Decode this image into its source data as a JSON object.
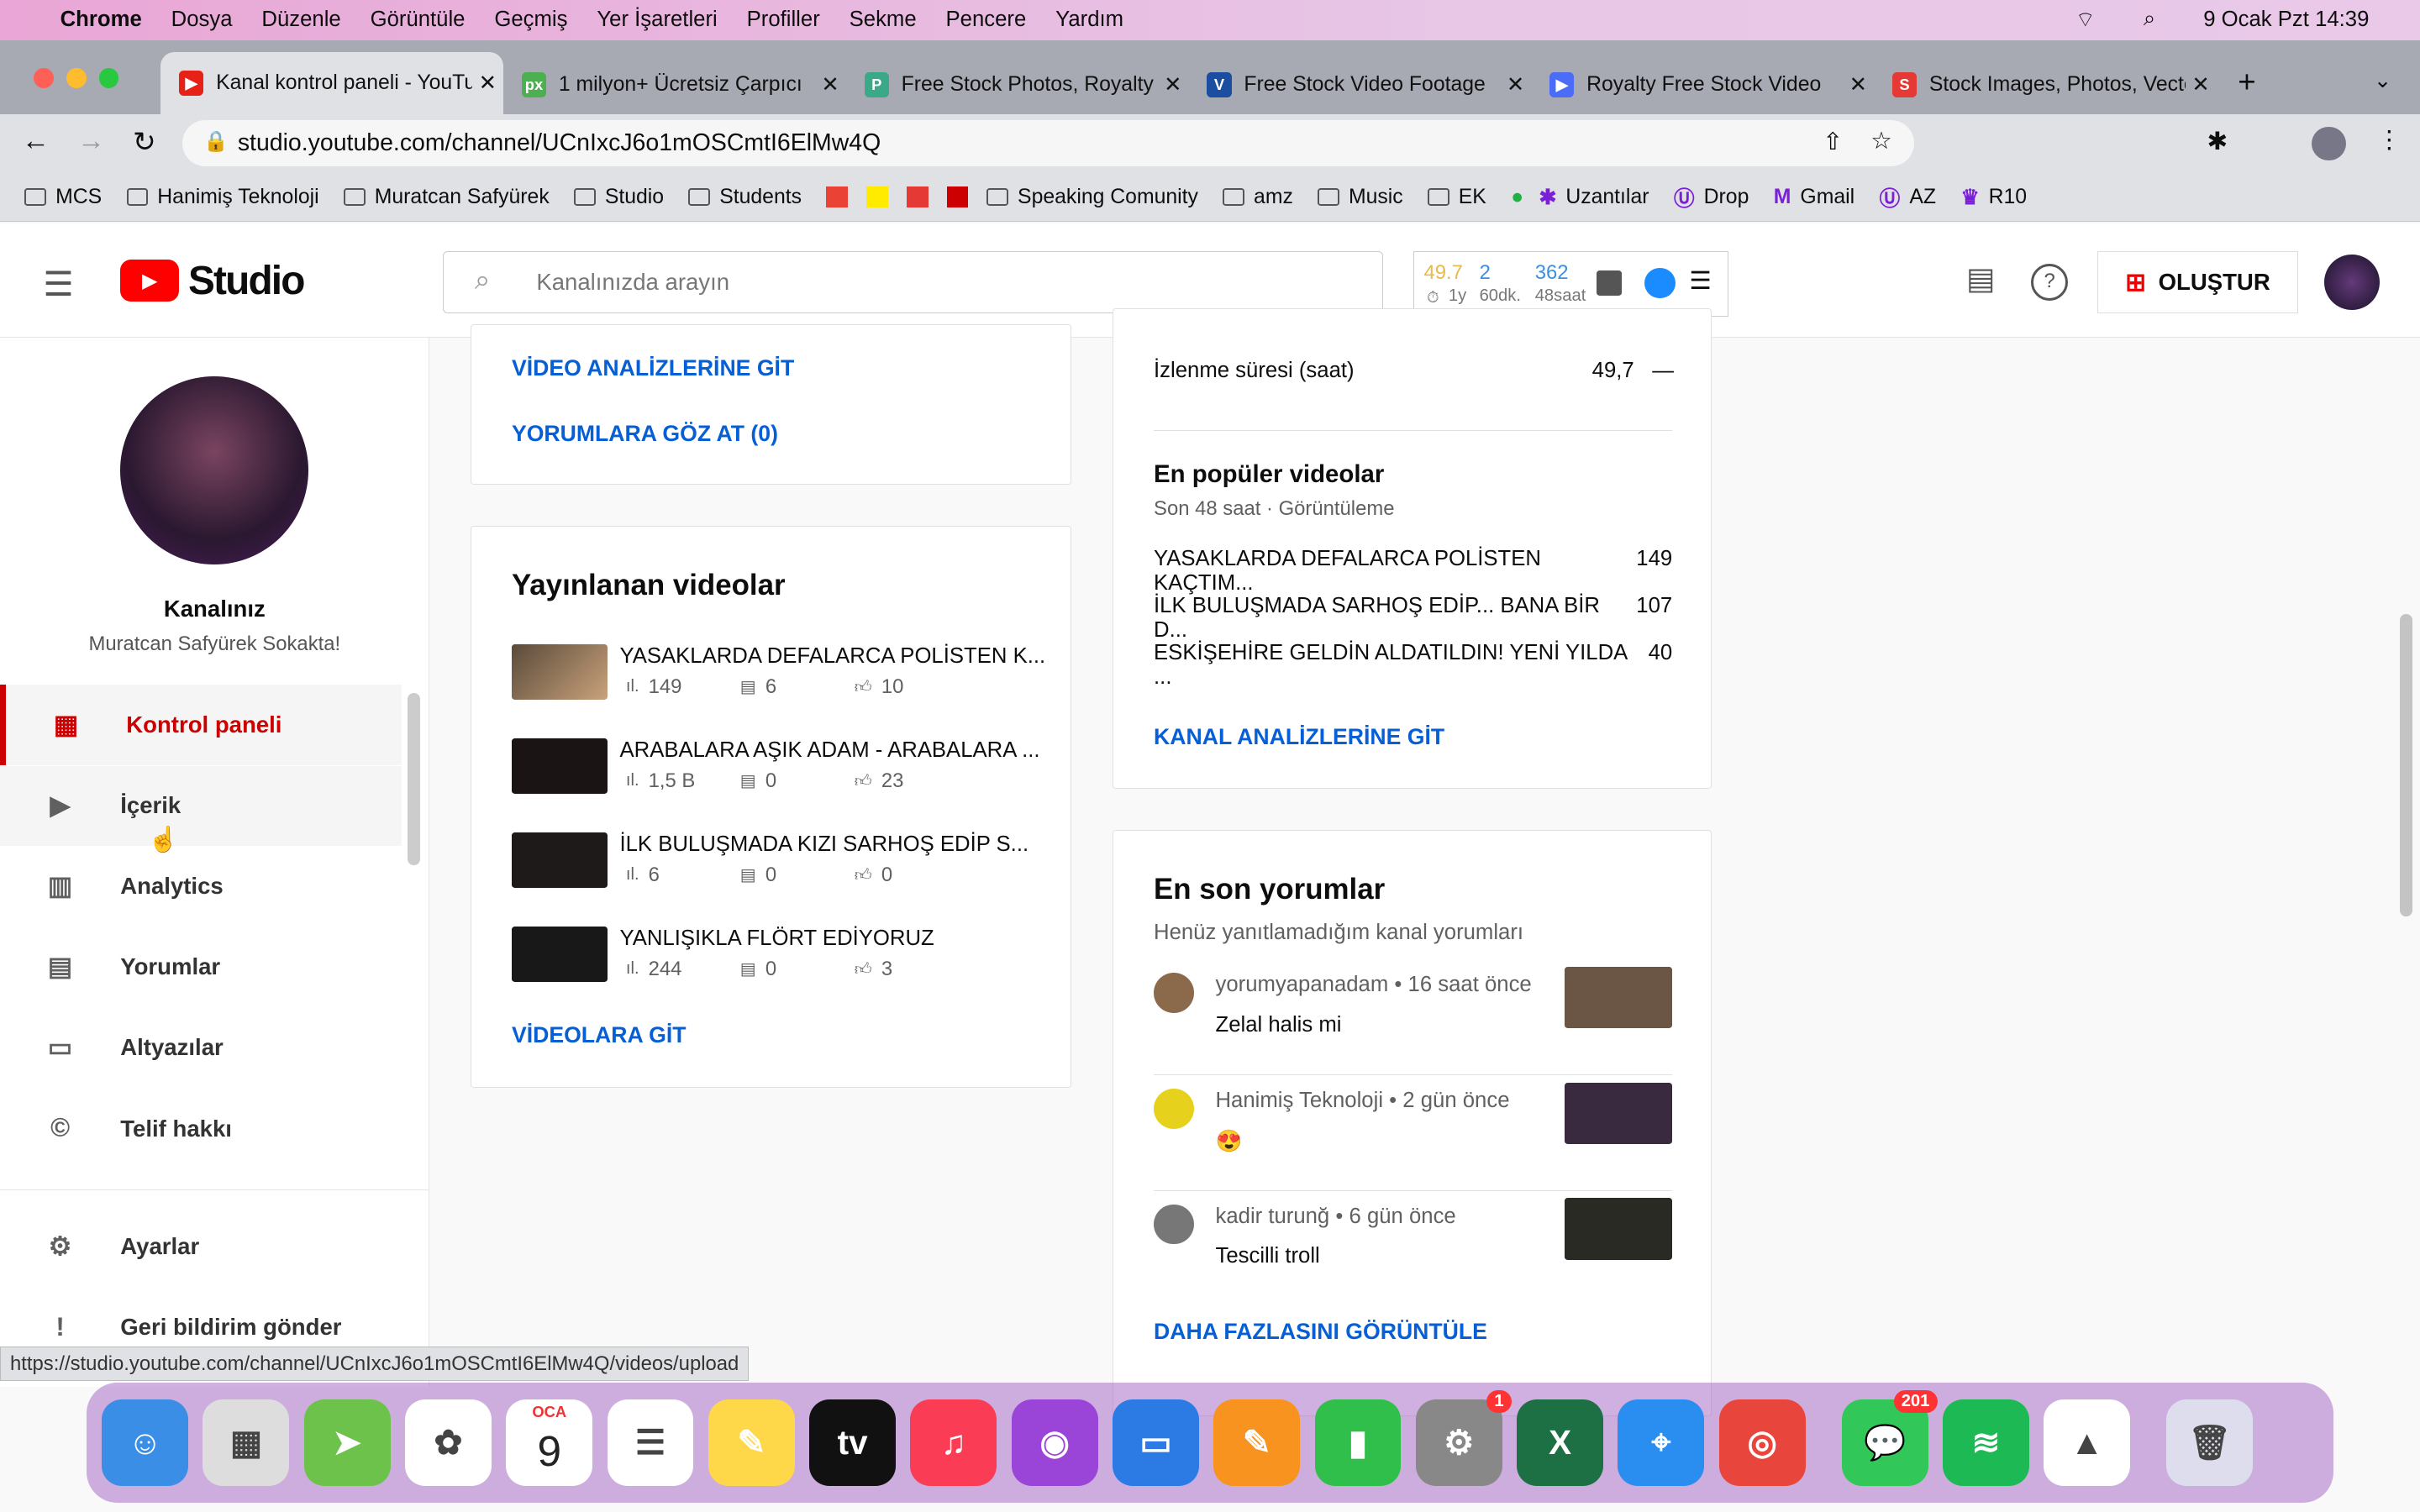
{
  "menubar": {
    "app": "Chrome",
    "items": [
      "Dosya",
      "Düzenle",
      "Görüntüle",
      "Geçmiş",
      "Yer İşaretleri",
      "Profiller",
      "Sekme",
      "Pencere",
      "Yardım"
    ],
    "clock": "9 Ocak Pzt  14:39"
  },
  "tabs": [
    {
      "title": "Kanal kontrol paneli - YouTube Studio",
      "color": "#e62117",
      "fav": "▶"
    },
    {
      "title": "1 milyon+ Ücretsiz Çarpıcı",
      "color": "#4caf50",
      "fav": "px"
    },
    {
      "title": "Free Stock Photos, Royalty",
      "color": "#39a987",
      "fav": "P"
    },
    {
      "title": "Free Stock Video Footage",
      "color": "#1b4ea0",
      "fav": "V"
    },
    {
      "title": "Royalty Free Stock Video",
      "color": "#4a6cf7",
      "fav": "▶"
    },
    {
      "title": "Stock Images, Photos, Vectors",
      "color": "#e53935",
      "fav": "S"
    }
  ],
  "url": "studio.youtube.com/channel/UCnIxcJ6o1mOSCmtI6ElMw4Q",
  "bookmarks": [
    "MCS",
    "Hanimiş Teknoloji",
    "Muratcan Safyürek",
    "Studio",
    "Students",
    "Speaking Comunity",
    "amz",
    "Music",
    "EK",
    "Uzantılar",
    "Drop",
    "Gmail",
    "AZ",
    "R10"
  ],
  "header": {
    "logo": "Studio",
    "search_placeholder": "Kanalınızda arayın",
    "create": "OLUŞTUR",
    "widget": {
      "v1": "49.7",
      "l1": "1y",
      "v2": "2",
      "l2": "60dk.",
      "v3": "362",
      "l3": "48saat"
    }
  },
  "sidebar": {
    "channel_label": "Kanalınız",
    "channel_name": "Muratcan Safyürek Sokakta!",
    "items": [
      "Kontrol paneli",
      "İçerik",
      "Analytics",
      "Yorumlar",
      "Altyazılar",
      "Telif hakkı",
      "Ayarlar",
      "Geri bildirim gönder"
    ]
  },
  "card1": {
    "link1": "VİDEO ANALİZLERİNE GİT",
    "link2": "YORUMLARA GÖZ AT (0)"
  },
  "published": {
    "title": "Yayınlanan videolar",
    "link": "VİDEOLARA GİT",
    "videos": [
      {
        "title": "YASAKLARDA DEFALARCA POLİSTEN K...",
        "views": "149",
        "comments": "6",
        "likes": "10"
      },
      {
        "title": "ARABALARA AŞIK ADAM - ARABALARA ...",
        "views": "1,5 B",
        "comments": "0",
        "likes": "23"
      },
      {
        "title": "İLK BULUŞMADA KIZI SARHOŞ EDİP S...",
        "views": "6",
        "comments": "0",
        "likes": "0"
      },
      {
        "title": "YANLIŞIKLA FLÖRT EDİYORUZ",
        "views": "244",
        "comments": "0",
        "likes": "3"
      }
    ]
  },
  "analytics": {
    "watch_label": "İzlenme süresi (saat)",
    "watch_value": "49,7",
    "watch_trend": "—",
    "popular_title": "En popüler videolar",
    "popular_sub": "Son 48 saat · Görüntüleme",
    "popular": [
      {
        "title": "YASAKLARDA DEFALARCA POLİSTEN KAÇTIM...",
        "value": "149"
      },
      {
        "title": "İLK BULUŞMADA SARHOŞ EDİP... BANA BİR D...",
        "value": "107"
      },
      {
        "title": "ESKİŞEHİRE GELDİN ALDATILDIN! YENİ YILDA ...",
        "value": "40"
      }
    ],
    "link": "KANAL ANALİZLERİNE GİT"
  },
  "comments": {
    "title": "En son yorumlar",
    "sub": "Henüz yanıtlamadığım kanal yorumları",
    "link": "DAHA FAZLASINI GÖRÜNTÜLE",
    "items": [
      {
        "meta": "yorumyapanadam • 16 saat önce",
        "text": "Zelal halis mi"
      },
      {
        "meta": "Hanimiş Teknoloji • 2 gün önce",
        "text": "😍"
      },
      {
        "meta": "kadir turunğ • 6 gün önce",
        "text": "Tescilli troll"
      }
    ]
  },
  "statusbar": "https://studio.youtube.com/channel/UCnIxcJ6o1mOSCmtI6ElMw4Q/videos/upload",
  "dock": {
    "calendar_month": "OCA",
    "calendar_day": "9",
    "settings_badge": "1",
    "messages_badge": "201"
  }
}
